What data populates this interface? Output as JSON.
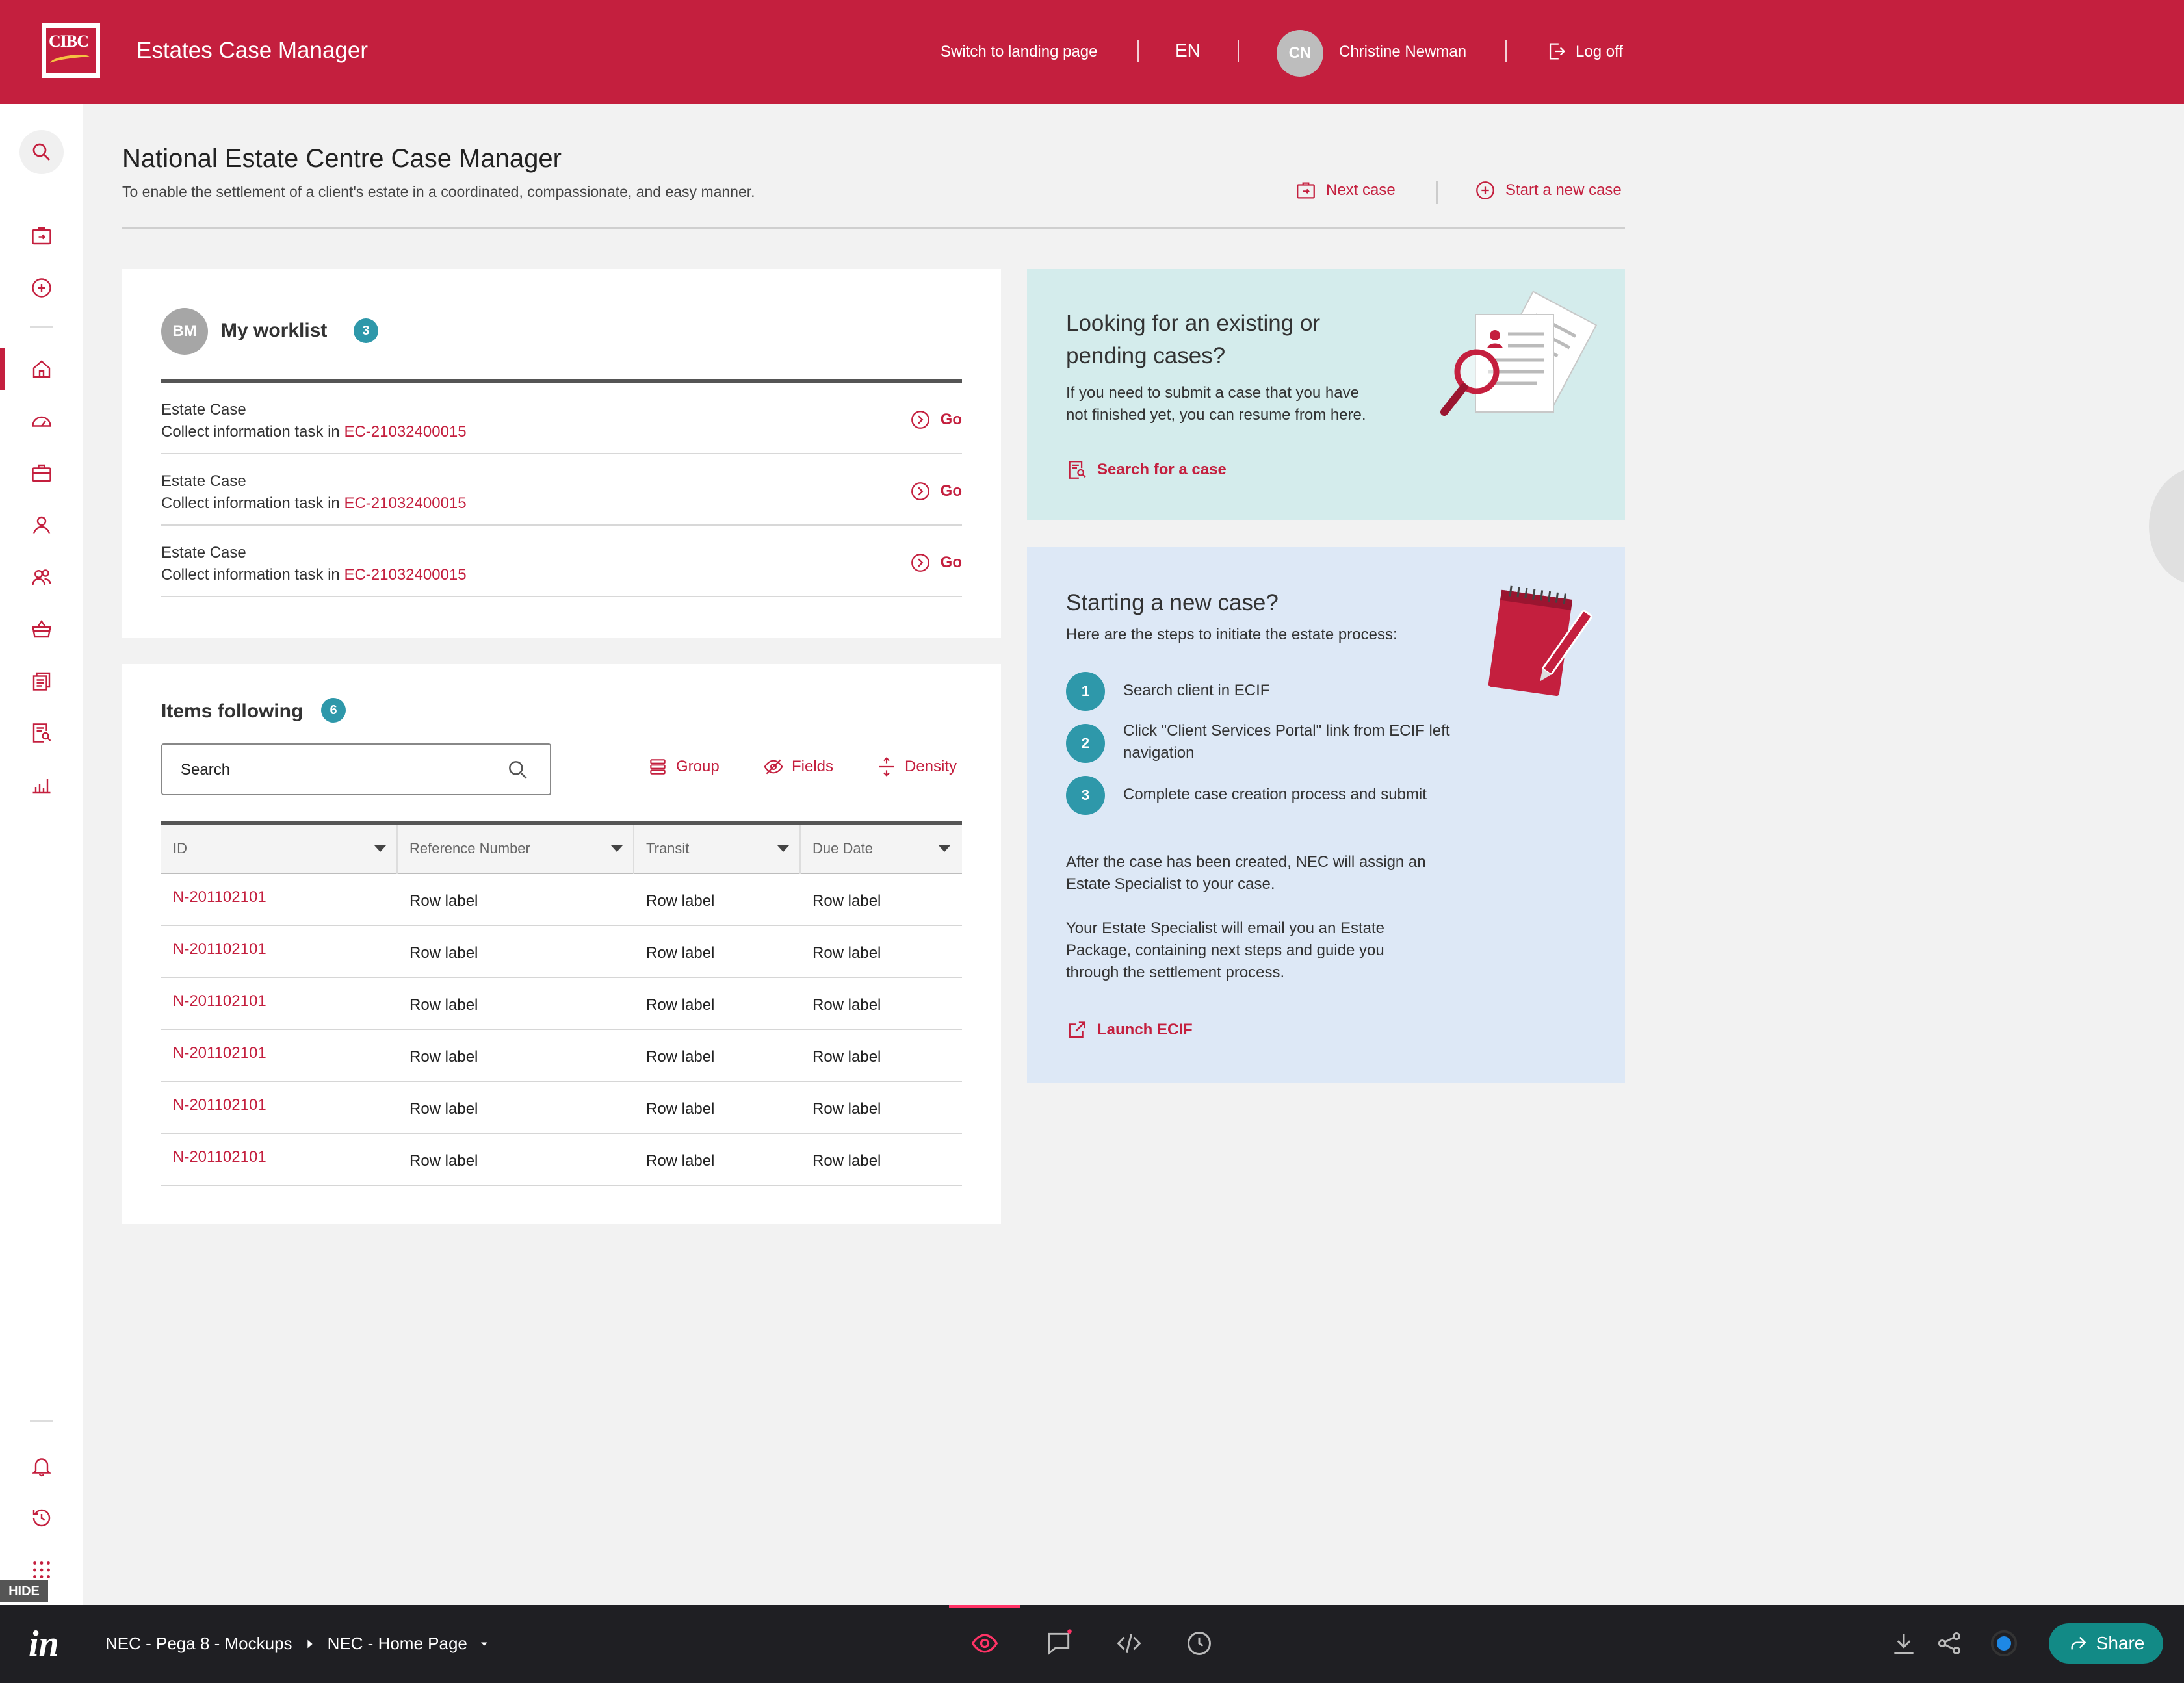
{
  "header": {
    "logo_text": "CIBC",
    "app_title": "Estates Case Manager",
    "landing_link": "Switch to landing page",
    "language": "EN",
    "user_initials": "CN",
    "user_name": "Christine Newman",
    "logoff": "Log off"
  },
  "page": {
    "title": "National Estate Centre Case Manager",
    "subtitle": "To enable the settlement of a client's estate in a coordinated, compassionate, and easy manner.",
    "next_case": "Next case",
    "start_case": "Start a new case"
  },
  "worklist": {
    "avatar": "BM",
    "title": "My worklist",
    "count": "3",
    "rows": [
      {
        "type": "Estate Case",
        "task": "Collect information task in",
        "case_id": "EC-21032400015",
        "go": "Go"
      },
      {
        "type": "Estate Case",
        "task": "Collect information task in",
        "case_id": "EC-21032400015",
        "go": "Go"
      },
      {
        "type": "Estate Case",
        "task": "Collect information task in",
        "case_id": "EC-21032400015",
        "go": "Go"
      }
    ]
  },
  "following": {
    "title": "Items following",
    "count": "6",
    "search_placeholder": "Search",
    "group": "Group",
    "fields": "Fields",
    "density": "Density",
    "columns": [
      "ID",
      "Reference Number",
      "Transit",
      "Due Date"
    ],
    "rows": [
      [
        "N-201102101",
        "Row label",
        "Row label",
        "Row label"
      ],
      [
        "N-201102101",
        "Row label",
        "Row label",
        "Row label"
      ],
      [
        "N-201102101",
        "Row label",
        "Row label",
        "Row label"
      ],
      [
        "N-201102101",
        "Row label",
        "Row label",
        "Row label"
      ],
      [
        "N-201102101",
        "Row label",
        "Row label",
        "Row label"
      ],
      [
        "N-201102101",
        "Row label",
        "Row label",
        "Row label"
      ]
    ]
  },
  "existing": {
    "title_line1": "Looking for an existing or",
    "title_line2": "pending cases?",
    "text_line1": "If you need to submit a case that you have",
    "text_line2": "not finished yet, you can resume from here.",
    "link": "Search for a case"
  },
  "newcase": {
    "title": "Starting a new case?",
    "intro": "Here are the steps to initiate the estate process:",
    "steps": [
      {
        "num": "1",
        "text": "Search client in ECIF"
      },
      {
        "num": "2",
        "text": "Click \"Client Services Portal\" link from ECIF left navigation"
      },
      {
        "num": "3",
        "text": "Complete case creation process and submit"
      }
    ],
    "after": "After the case has been created, NEC will assign an Estate Specialist to your case.",
    "specialist": "Your Estate Specialist will email you an Estate Package, containing next steps and guide you through the settlement process.",
    "link": "Launch ECIF"
  },
  "rail": {
    "hide": "HIDE"
  },
  "bottom": {
    "logo": "in",
    "project": "NEC - Pega 8 - Mockups",
    "screen": "NEC - Home Page",
    "share": "Share"
  },
  "colors": {
    "brand": "#c41f3e",
    "teal": "#2e98aa",
    "panel_teal": "#d4ecec",
    "panel_blue": "#dde8f6"
  }
}
